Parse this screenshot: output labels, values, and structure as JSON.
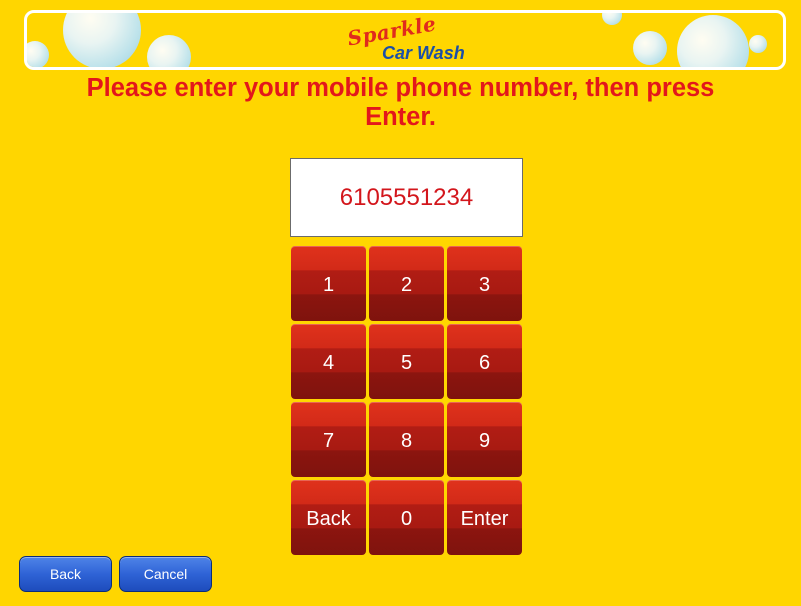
{
  "header": {
    "logo_top": "Sparkle",
    "logo_bottom": "Car Wash"
  },
  "prompt": {
    "line1": "Please enter your mobile phone number, then press",
    "line2": "Enter."
  },
  "phone_display": {
    "value": "6105551234"
  },
  "keypad": {
    "keys": [
      "1",
      "2",
      "3",
      "4",
      "5",
      "6",
      "7",
      "8",
      "9",
      "Back",
      "0",
      "Enter"
    ]
  },
  "footer": {
    "back_label": "Back",
    "cancel_label": "Cancel"
  },
  "colors": {
    "background": "#FFD600",
    "prompt_text": "#E3171B",
    "key_red": "#C52417",
    "button_blue": "#2F63D6"
  }
}
